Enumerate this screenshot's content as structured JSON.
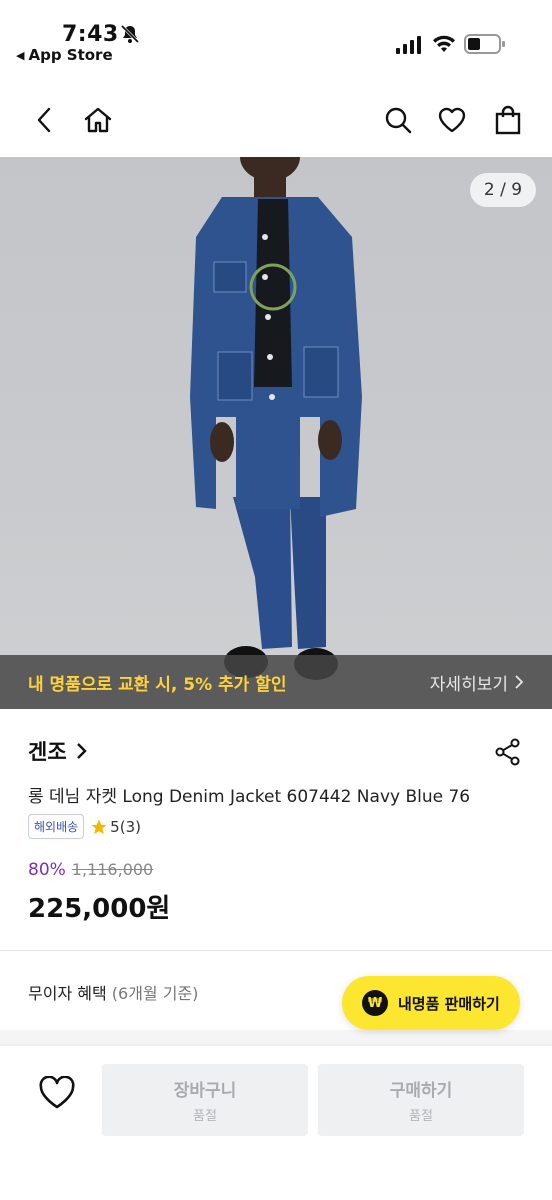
{
  "status_bar": {
    "time": "7:43",
    "back_app": "App Store"
  },
  "hero": {
    "page_counter": "2 / 9",
    "promo_text": "내 명품으로 교환 시, 5% 추가 할인",
    "promo_more": "자세히보기"
  },
  "product": {
    "brand": "겐조",
    "name": "롱 데님 자켓 Long Denim Jacket 607442 Navy Blue 76",
    "badge": "해외배송",
    "rating": "5(3)",
    "discount": "80%",
    "original_price": "1,116,000",
    "price": "225,000원"
  },
  "installment": {
    "label": "무이자 혜택",
    "sub": "(6개월 기준)"
  },
  "sell_button": {
    "label": "내명품 판매하기",
    "icon_text": "₩"
  },
  "bottom_bar": {
    "cart_label": "장바구니",
    "cart_sub": "품절",
    "buy_label": "구매하기",
    "buy_sub": "품절"
  },
  "colors": {
    "accent_yellow": "#fde630",
    "promo_yellow": "#ffd23a",
    "discount_purple": "#7b2fbe"
  },
  "icons": [
    "bell-off-icon",
    "back-icon",
    "home-icon",
    "search-icon",
    "heart-icon",
    "bag-icon",
    "share-icon",
    "star-icon",
    "chevron-right-icon"
  ]
}
